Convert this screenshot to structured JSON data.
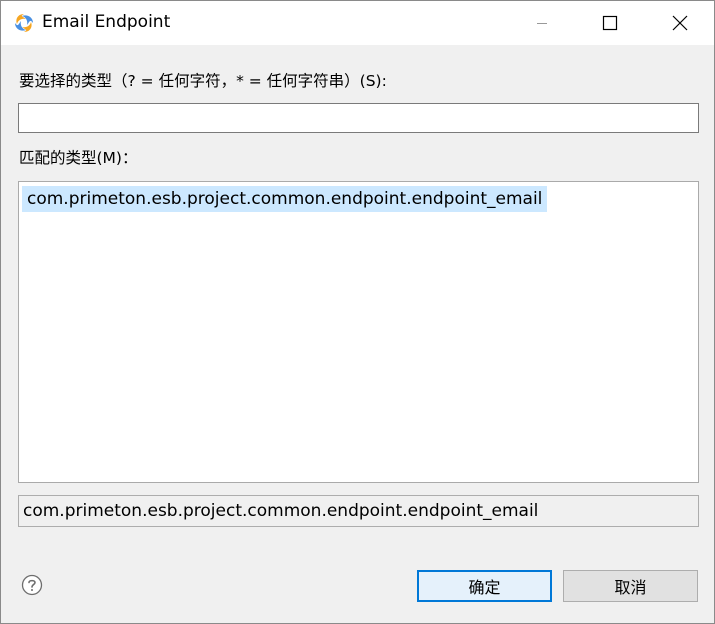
{
  "window": {
    "title": "Email Endpoint"
  },
  "pattern": {
    "label": "要选择的类型（? = 任何字符，* = 任何字符串）(S):",
    "value": ""
  },
  "matching": {
    "label": "匹配的类型(M)：",
    "items": [
      {
        "label": "com.primeton.esb.project.common.endpoint.endpoint_email",
        "selected": true
      }
    ]
  },
  "detail": {
    "text": "com.primeton.esb.project.common.endpoint.endpoint_email"
  },
  "buttons": {
    "ok": "确定",
    "cancel": "取消"
  },
  "icons": {
    "app": "swirl-app-icon",
    "help": "help-icon",
    "minimize": "minimize-icon",
    "maximize": "maximize-icon",
    "close": "close-icon"
  },
  "colors": {
    "selection": "#cce8ff",
    "focus_border": "#0078d7"
  }
}
